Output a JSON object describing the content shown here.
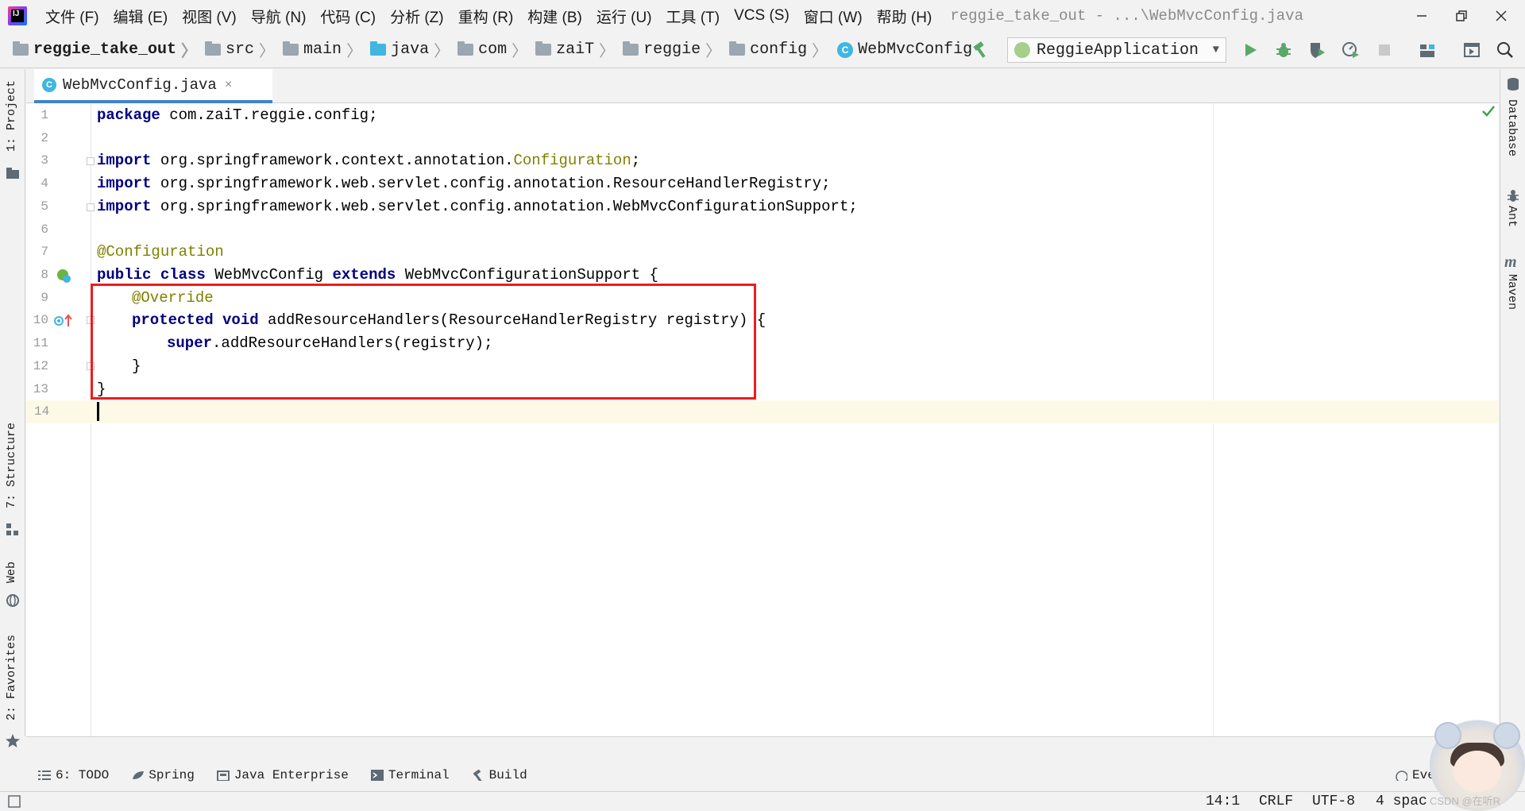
{
  "menubar": {
    "items": [
      "文件 (F)",
      "编辑 (E)",
      "视图 (V)",
      "导航 (N)",
      "代码 (C)",
      "分析 (Z)",
      "重构 (R)",
      "构建 (B)",
      "运行 (U)",
      "工具 (T)",
      "VCS (S)",
      "窗口 (W)",
      "帮助 (H)"
    ],
    "window_title": "reggie_take_out - ...\\WebMvcConfig.java"
  },
  "breadcrumbs": {
    "project": "reggie_take_out",
    "items": [
      "src",
      "main",
      "java",
      "com",
      "zaiT",
      "reggie",
      "config"
    ],
    "class": "WebMvcConfig",
    "class_icon_letter": "C"
  },
  "run_config": {
    "label": "ReggieApplication"
  },
  "left_tool_tabs": {
    "project": "1: Project",
    "structure": "7: Structure",
    "web": "Web",
    "favorites": "2: Favorites"
  },
  "right_tool_tabs": {
    "database": "Database",
    "ant": "Ant",
    "maven": "Maven"
  },
  "editor_tab": {
    "label": "WebMvcConfig.java",
    "icon_letter": "C",
    "close": "×"
  },
  "code_lines": {
    "n1": "1",
    "n2": "2",
    "n3": "3",
    "n4": "4",
    "n5": "5",
    "n6": "6",
    "n7": "7",
    "n8": "8",
    "n9": "9",
    "n10": "10",
    "n11": "11",
    "n12": "12",
    "n13": "13",
    "n14": "14",
    "l1_kw": "package",
    "l1_rest": " com.zaiT.reggie.config;",
    "l3_kw": "import",
    "l3_rest": " org.springframework.context.annotation.",
    "l3_cls": "Configuration",
    "l3_end": ";",
    "l4_kw": "import",
    "l4_rest": " org.springframework.web.servlet.config.annotation.ResourceHandlerRegistry;",
    "l5_kw": "import",
    "l5_rest": " org.springframework.web.servlet.config.annotation.WebMvcConfigurationSupport;",
    "l7_ann": "@Configuration",
    "l8_kw1": "public class",
    "l8_mid": " WebMvcConfig ",
    "l8_kw2": "extends",
    "l8_rest": " WebMvcConfigurationSupport {",
    "l9_ann": "@Override",
    "l10_kw": "protected void",
    "l10_rest": " addResourceHandlers(ResourceHandlerRegistry registry) {",
    "l11_kw": "super",
    "l11_rest": ".addResourceHandlers(registry);",
    "l12": "}",
    "l13": "}"
  },
  "bottom_tabs": {
    "todo": "6: TODO",
    "spring": "Spring",
    "java_enterprise": "Java Enterprise",
    "terminal": "Terminal",
    "build": "Build",
    "event_log": "Eve"
  },
  "status": {
    "position": "14:1",
    "line_sep": "CRLF",
    "encoding": "UTF-8",
    "indent": "4 spac"
  },
  "watermark": "CSDN @在听R",
  "colors": {
    "keyword": "#000080",
    "annotation": "#808000",
    "highlight_box": "#ee1c1c",
    "current_line": "#fcfae7",
    "tab_underline": "#4083c9"
  }
}
